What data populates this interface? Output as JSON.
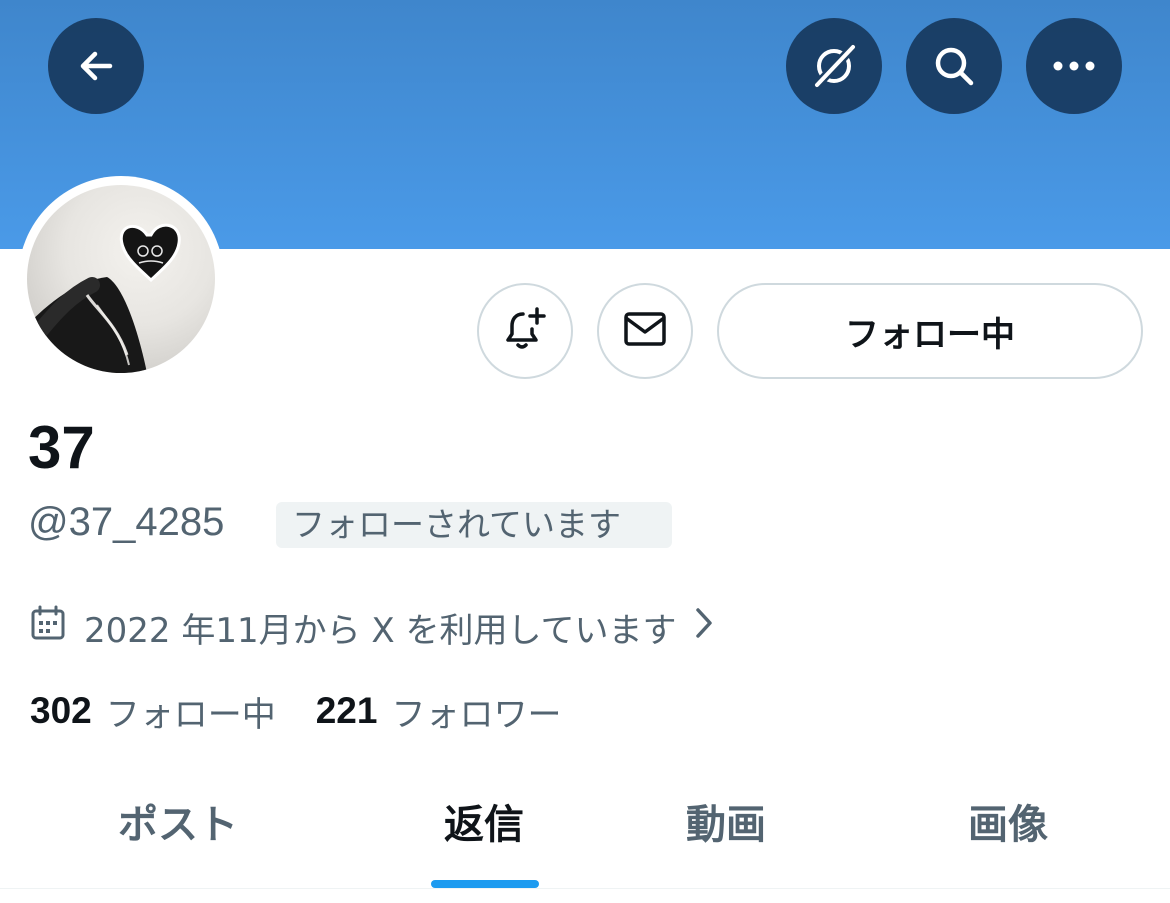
{
  "header": {
    "back_icon": "arrow-left-icon",
    "grok_icon": "grok-icon",
    "search_icon": "search-icon",
    "more_icon": "more-horizontal-icon",
    "banner_color": "#4a9ae8"
  },
  "profile": {
    "display_name": "37",
    "handle": "@37_4285",
    "follows_you_badge": "フォローされています",
    "joined_text": "2022 年11月から X を利用しています",
    "following_count": "302",
    "following_label": "フォロー中",
    "followers_count": "221",
    "followers_label": "フォロワー"
  },
  "actions": {
    "notify_icon": "bell-plus-icon",
    "message_icon": "envelope-icon",
    "follow_button_label": "フォロー中"
  },
  "tabs": [
    {
      "label": "ポスト",
      "active": false
    },
    {
      "label": "返信",
      "active": true
    },
    {
      "label": "動画",
      "active": false
    },
    {
      "label": "画像",
      "active": false
    }
  ],
  "colors": {
    "accent": "#1d9bf0",
    "text_primary": "#0f1419",
    "text_secondary": "#536471"
  }
}
